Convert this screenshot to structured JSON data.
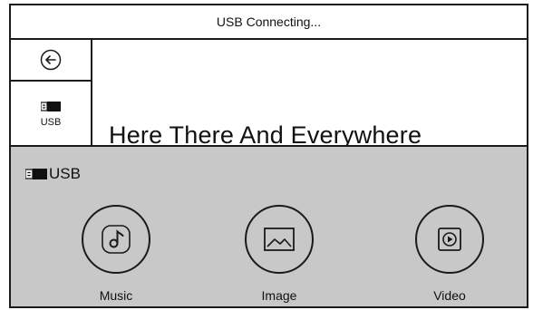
{
  "header": {
    "title": "USB Connecting..."
  },
  "sidebar": {
    "back_icon": "back-arrow-icon",
    "usb_tile": {
      "label": "USB",
      "icon": "usb-drive-icon"
    }
  },
  "now_playing": {
    "title": "Here There And Everywhere"
  },
  "source_panel": {
    "title": "USB",
    "icon": "usb-drive-icon",
    "items": [
      {
        "label": "Music",
        "icon": "music-note-icon"
      },
      {
        "label": "Image",
        "icon": "image-icon"
      },
      {
        "label": "Video",
        "icon": "video-play-icon"
      }
    ]
  },
  "colors": {
    "panel_background": "#c8c8c8",
    "line": "#1a1a1a",
    "background": "#ffffff"
  }
}
